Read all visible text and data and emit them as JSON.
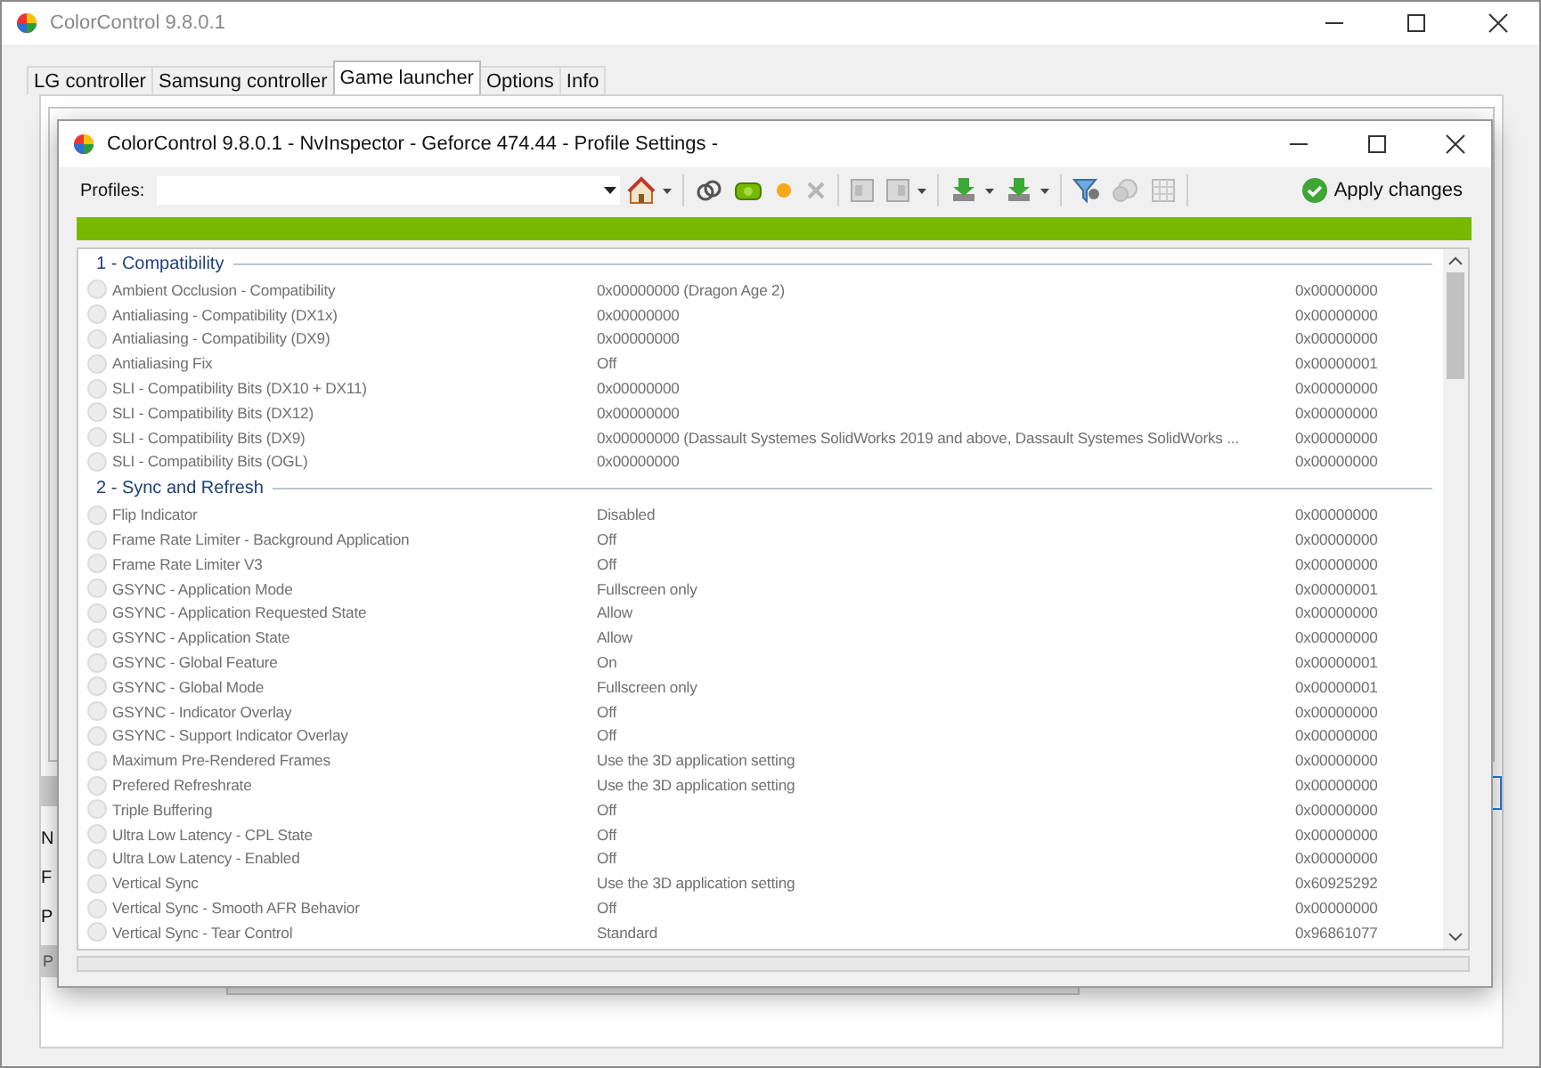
{
  "window": {
    "title": "ColorControl 9.8.0.1"
  },
  "tabs": [
    {
      "label": "LG controller",
      "selected": false
    },
    {
      "label": "Samsung controller",
      "selected": false
    },
    {
      "label": "Game launcher",
      "selected": true
    },
    {
      "label": "Options",
      "selected": false
    },
    {
      "label": "Info",
      "selected": false
    }
  ],
  "background_labels": [
    "N",
    "F",
    "P"
  ],
  "background_button": "P",
  "dialog": {
    "title": "ColorControl 9.8.0.1 - NvInspector - Geforce 474.44 - Profile Settings -",
    "profiles_label": "Profiles:",
    "apply_button": "Apply changes",
    "sections": [
      {
        "title": "1 - Compatibility",
        "settings": [
          {
            "name": "Ambient Occlusion - Compatibility",
            "value": "0x00000000 (Dragon Age 2)",
            "hex": "0x00000000"
          },
          {
            "name": "Antialiasing - Compatibility (DX1x)",
            "value": "0x00000000",
            "hex": "0x00000000"
          },
          {
            "name": "Antialiasing - Compatibility (DX9)",
            "value": "0x00000000",
            "hex": "0x00000000"
          },
          {
            "name": "Antialiasing Fix",
            "value": "Off",
            "hex": "0x00000001"
          },
          {
            "name": "SLI - Compatibility Bits (DX10 + DX11)",
            "value": "0x00000000",
            "hex": "0x00000000"
          },
          {
            "name": "SLI - Compatibility Bits (DX12)",
            "value": "0x00000000",
            "hex": "0x00000000"
          },
          {
            "name": "SLI - Compatibility Bits (DX9)",
            "value": "0x00000000 (Dassault Systemes SolidWorks 2019 and above, Dassault Systemes SolidWorks ...",
            "hex": "0x00000000"
          },
          {
            "name": "SLI - Compatibility Bits (OGL)",
            "value": "0x00000000",
            "hex": "0x00000000"
          }
        ]
      },
      {
        "title": "2 - Sync and Refresh",
        "settings": [
          {
            "name": "Flip Indicator",
            "value": "Disabled",
            "hex": "0x00000000"
          },
          {
            "name": "Frame Rate Limiter - Background Application",
            "value": "Off",
            "hex": "0x00000000"
          },
          {
            "name": "Frame Rate Limiter V3",
            "value": "Off",
            "hex": "0x00000000"
          },
          {
            "name": "GSYNC - Application Mode",
            "value": "Fullscreen only",
            "hex": "0x00000001"
          },
          {
            "name": "GSYNC - Application Requested State",
            "value": "Allow",
            "hex": "0x00000000"
          },
          {
            "name": "GSYNC - Application State",
            "value": "Allow",
            "hex": "0x00000000"
          },
          {
            "name": "GSYNC - Global Feature",
            "value": "On",
            "hex": "0x00000001"
          },
          {
            "name": "GSYNC - Global Mode",
            "value": "Fullscreen only",
            "hex": "0x00000001"
          },
          {
            "name": "GSYNC - Indicator Overlay",
            "value": "Off",
            "hex": "0x00000000"
          },
          {
            "name": "GSYNC - Support Indicator Overlay",
            "value": "Off",
            "hex": "0x00000000"
          },
          {
            "name": "Maximum Pre-Rendered Frames",
            "value": "Use the 3D application setting",
            "hex": "0x00000000"
          },
          {
            "name": "Prefered Refreshrate",
            "value": "Use the 3D application setting",
            "hex": "0x00000000"
          },
          {
            "name": "Triple Buffering",
            "value": "Off",
            "hex": "0x00000000"
          },
          {
            "name": "Ultra Low Latency - CPL State",
            "value": "Off",
            "hex": "0x00000000"
          },
          {
            "name": "Ultra Low Latency - Enabled",
            "value": "Off",
            "hex": "0x00000000"
          },
          {
            "name": "Vertical Sync",
            "value": "Use the 3D application setting",
            "hex": "0x60925292"
          },
          {
            "name": "Vertical Sync - Smooth AFR Behavior",
            "value": "Off",
            "hex": "0x00000000"
          },
          {
            "name": "Vertical Sync - Tear Control",
            "value": "Standard",
            "hex": "0x96861077"
          }
        ]
      }
    ]
  }
}
